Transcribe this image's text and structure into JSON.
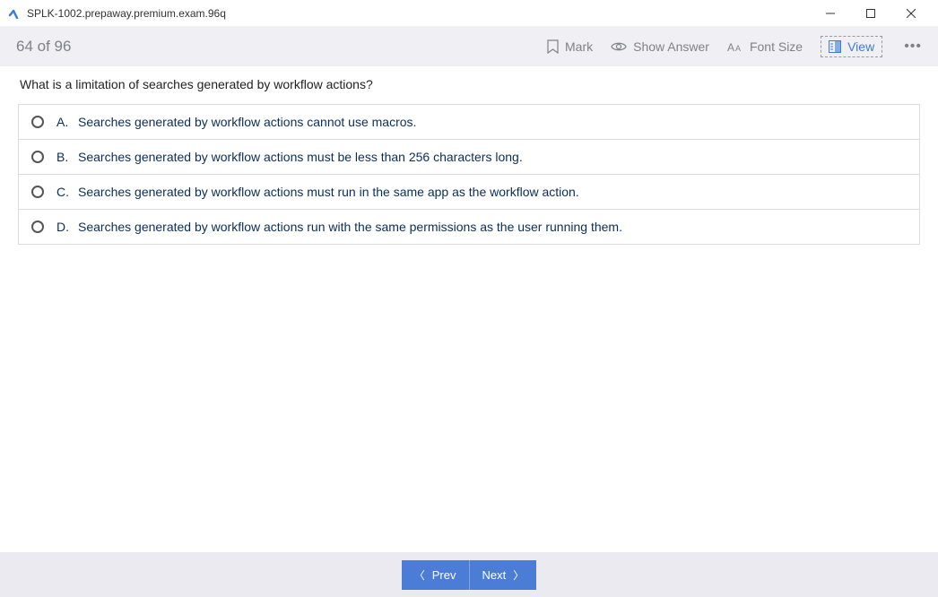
{
  "window": {
    "title": "SPLK-1002.prepaway.premium.exam.96q"
  },
  "toolbar": {
    "progress": "64 of 96",
    "mark": "Mark",
    "show_answer": "Show Answer",
    "font_size": "Font Size",
    "view": "View"
  },
  "question": {
    "text": "What is a limitation of searches generated by workflow actions?",
    "options": [
      {
        "letter": "A.",
        "text": "Searches generated by workflow actions cannot use macros."
      },
      {
        "letter": "B.",
        "text": "Searches generated by workflow actions must be less than 256 characters long."
      },
      {
        "letter": "C.",
        "text": "Searches generated by workflow actions must run in the same app as the workflow action."
      },
      {
        "letter": "D.",
        "text": "Searches generated by workflow actions run with the same permissions as the user running them."
      }
    ]
  },
  "footer": {
    "prev": "Prev",
    "next": "Next"
  }
}
